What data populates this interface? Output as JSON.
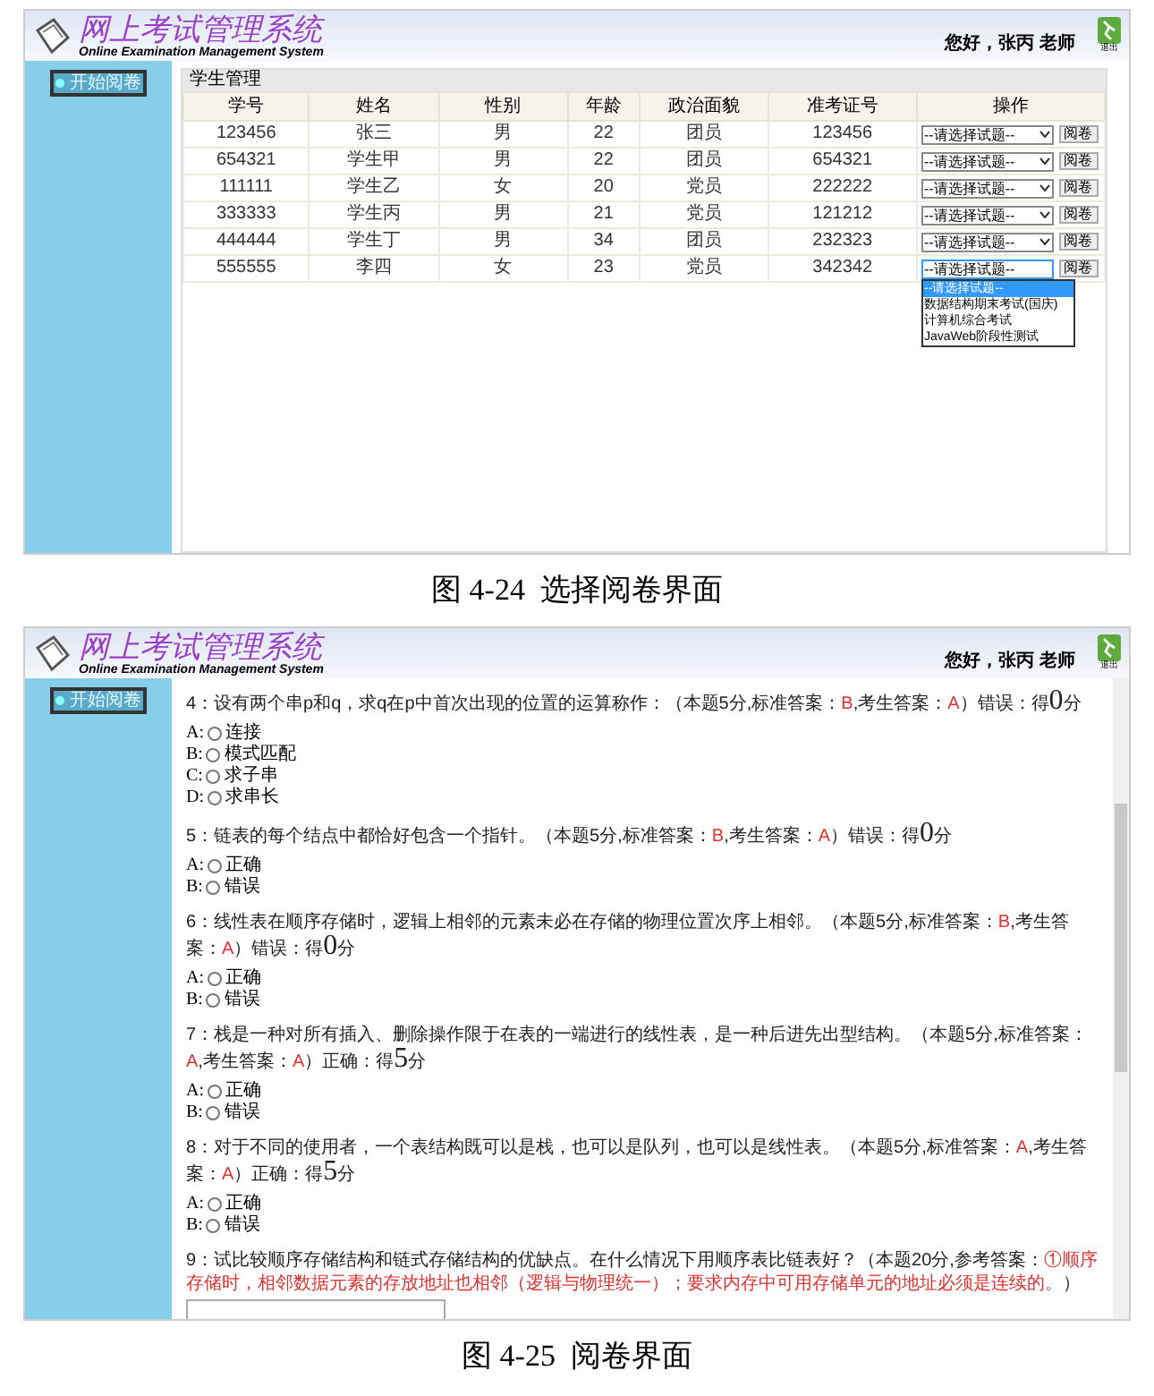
{
  "figures": [
    {
      "kind": "student_list",
      "header": {
        "title": "网上考试管理系统",
        "subtitle": "Online Examination Management System",
        "greeting": "您好，张丙 老师",
        "exit": "退出"
      },
      "sidebar": {
        "button": "开始阅卷"
      },
      "panel_title": "学生管理",
      "table": {
        "columns": [
          "学号",
          "姓名",
          "性别",
          "年龄",
          "政治面貌",
          "准考证号",
          "操作"
        ],
        "rows": [
          {
            "cells": [
              "123456",
              "张三",
              "男",
              "22",
              "团员",
              "123456"
            ],
            "select": "--请选择试题--",
            "button": "阅卷",
            "expanded": false
          },
          {
            "cells": [
              "654321",
              "学生甲",
              "男",
              "22",
              "团员",
              "654321"
            ],
            "select": "--请选择试题--",
            "button": "阅卷",
            "expanded": false
          },
          {
            "cells": [
              "111111",
              "学生乙",
              "女",
              "20",
              "党员",
              "222222"
            ],
            "select": "--请选择试题--",
            "button": "阅卷",
            "expanded": false
          },
          {
            "cells": [
              "333333",
              "学生丙",
              "男",
              "21",
              "党员",
              "121212"
            ],
            "select": "--请选择试题--",
            "button": "阅卷",
            "expanded": false
          },
          {
            "cells": [
              "444444",
              "学生丁",
              "男",
              "34",
              "团员",
              "232323"
            ],
            "select": "--请选择试题--",
            "button": "阅卷",
            "expanded": false
          },
          {
            "cells": [
              "555555",
              "李四",
              "女",
              "23",
              "党员",
              "342342"
            ],
            "select": "--请选择试题--",
            "button": "阅卷",
            "expanded": true,
            "options": [
              {
                "label": "--请选择试题--",
                "selected": true
              },
              {
                "label": "数据结构期末考试(国庆)",
                "selected": false
              },
              {
                "label": "计算机综合考试",
                "selected": false
              },
              {
                "label": "JavaWeb阶段性测试",
                "selected": false
              }
            ]
          }
        ]
      },
      "caption": "图 4-24  选择阅卷界面"
    },
    {
      "kind": "grading",
      "header": {
        "title": "网上考试管理系统",
        "subtitle": "Online Examination Management System",
        "greeting": "您好，张丙 老师",
        "exit": "退出"
      },
      "sidebar": {
        "button": "开始阅卷"
      },
      "questions": [
        {
          "parts": [
            {
              "kind": "plain",
              "text": "4：设有两个串p和q，求q在p中首次出现的位置的运算称作：（本题5分,标准答案："
            },
            {
              "kind": "answer",
              "text": "B"
            },
            {
              "kind": "plain",
              "text": ",考生答案："
            },
            {
              "kind": "answer",
              "text": "A"
            },
            {
              "kind": "plain",
              "text": "）错误：得"
            },
            {
              "kind": "score",
              "text": "0"
            },
            {
              "kind": "plain",
              "text": "分"
            }
          ],
          "options": [
            {
              "letter": "A:",
              "text": "连接",
              "checked": false
            },
            {
              "letter": "B:",
              "text": "模式匹配",
              "checked": false
            },
            {
              "letter": "C:",
              "text": "求子串",
              "checked": false
            },
            {
              "letter": "D:",
              "text": "求串长",
              "checked": false
            }
          ]
        },
        {
          "parts": [
            {
              "kind": "plain",
              "text": "5：链表的每个结点中都恰好包含一个指针。（本题5分,标准答案："
            },
            {
              "kind": "answer",
              "text": "B"
            },
            {
              "kind": "plain",
              "text": ",考生答案："
            },
            {
              "kind": "answer",
              "text": "A"
            },
            {
              "kind": "plain",
              "text": "）错误：得"
            },
            {
              "kind": "score",
              "text": "0"
            },
            {
              "kind": "plain",
              "text": "分"
            }
          ],
          "options": [
            {
              "letter": "A:",
              "text": "正确",
              "checked": false
            },
            {
              "letter": "B:",
              "text": "错误",
              "checked": false
            }
          ]
        },
        {
          "parts": [
            {
              "kind": "plain",
              "text": "6：线性表在顺序存储时，逻辑上相邻的元素未必在存储的物理位置次序上相邻。（本题5分,标准答案："
            },
            {
              "kind": "answer",
              "text": "B"
            },
            {
              "kind": "plain",
              "text": ",考生答案："
            },
            {
              "kind": "answer",
              "text": "A"
            },
            {
              "kind": "plain",
              "text": "）错误：得"
            },
            {
              "kind": "score",
              "text": "0"
            },
            {
              "kind": "plain",
              "text": "分"
            }
          ],
          "options": [
            {
              "letter": "A:",
              "text": "正确",
              "checked": false
            },
            {
              "letter": "B:",
              "text": "错误",
              "checked": false
            }
          ]
        },
        {
          "parts": [
            {
              "kind": "plain",
              "text": "7：栈是一种对所有插入、删除操作限于在表的一端进行的线性表，是一种后进先出型结构。（本题5分,标准答案："
            },
            {
              "kind": "answer",
              "text": "A"
            },
            {
              "kind": "plain",
              "text": ",考生答案："
            },
            {
              "kind": "answer",
              "text": "A"
            },
            {
              "kind": "plain",
              "text": "）正确：得"
            },
            {
              "kind": "score",
              "text": "5"
            },
            {
              "kind": "plain",
              "text": "分"
            }
          ],
          "options": [
            {
              "letter": "A:",
              "text": "正确",
              "checked": false
            },
            {
              "letter": "B:",
              "text": "错误",
              "checked": false
            }
          ]
        },
        {
          "parts": [
            {
              "kind": "plain",
              "text": "8：对于不同的使用者，一个表结构既可以是栈，也可以是队列，也可以是线性表。（本题5分,标准答案："
            },
            {
              "kind": "answer",
              "text": "A"
            },
            {
              "kind": "plain",
              "text": ",考生答案："
            },
            {
              "kind": "answer",
              "text": "A"
            },
            {
              "kind": "plain",
              "text": "）正确：得"
            },
            {
              "kind": "score",
              "text": "5"
            },
            {
              "kind": "plain",
              "text": "分"
            }
          ],
          "options": [
            {
              "letter": "A:",
              "text": "正确",
              "checked": false
            },
            {
              "letter": "B:",
              "text": "错误",
              "checked": false
            }
          ]
        },
        {
          "parts": [
            {
              "kind": "plain",
              "text": "9：试比较顺序存储结构和链式存储结构的优缺点。在什么情况下用顺序表比链表好？（本题20分,参考答案："
            },
            {
              "kind": "answer",
              "text": "①顺序存储时，相邻数据元素的存放地址也相邻（逻辑与物理统一）；要求内存中可用存储单元的地址必须是连续的。"
            },
            {
              "kind": "plain",
              "text": "）"
            }
          ],
          "kind": "essay"
        }
      ],
      "caption": "图 4-25  阅卷界面"
    }
  ]
}
